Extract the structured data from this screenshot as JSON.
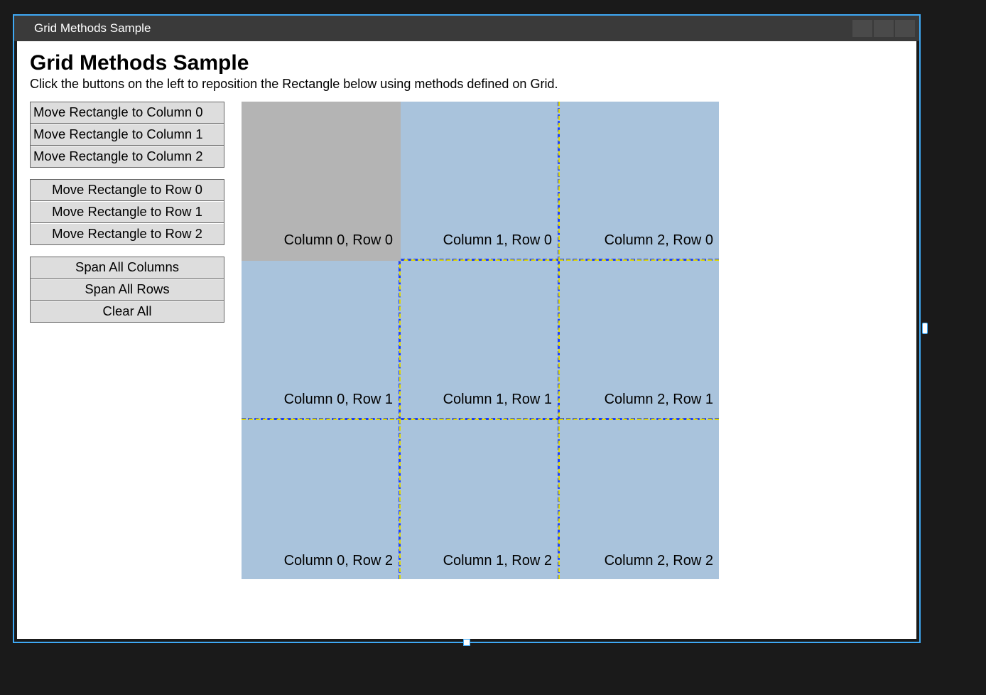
{
  "window": {
    "title": "Grid Methods Sample"
  },
  "page": {
    "heading": "Grid Methods Sample",
    "subtitle": "Click the buttons on the left to reposition the Rectangle below using methods defined on Grid."
  },
  "buttons": {
    "columnGroup": [
      "Move Rectangle to Column 0",
      "Move Rectangle to Column 1",
      "Move Rectangle to Column 2"
    ],
    "rowGroup": [
      "Move Rectangle to Row 0",
      "Move Rectangle to Row 1",
      "Move Rectangle to Row 2"
    ],
    "spanGroup": [
      "Span All Columns",
      "Span All Rows",
      "Clear All"
    ]
  },
  "grid": {
    "cells": [
      "Column 0, Row 0",
      "Column 1, Row 0",
      "Column 2, Row 0",
      "Column 0, Row 1",
      "Column 1, Row 1",
      "Column 2, Row 1",
      "Column 0, Row 2",
      "Column 1, Row 2",
      "Column 2, Row 2"
    ],
    "rectangle": {
      "col": 0,
      "row": 0,
      "colspan": 1,
      "rowspan": 1
    }
  },
  "colors": {
    "gridFill": "#a9c3dc",
    "rectFill": "#b4b4b4",
    "dashBlue": "#1b3fff",
    "dashYellow": "#e0d800",
    "selection": "#3fa9f5"
  }
}
